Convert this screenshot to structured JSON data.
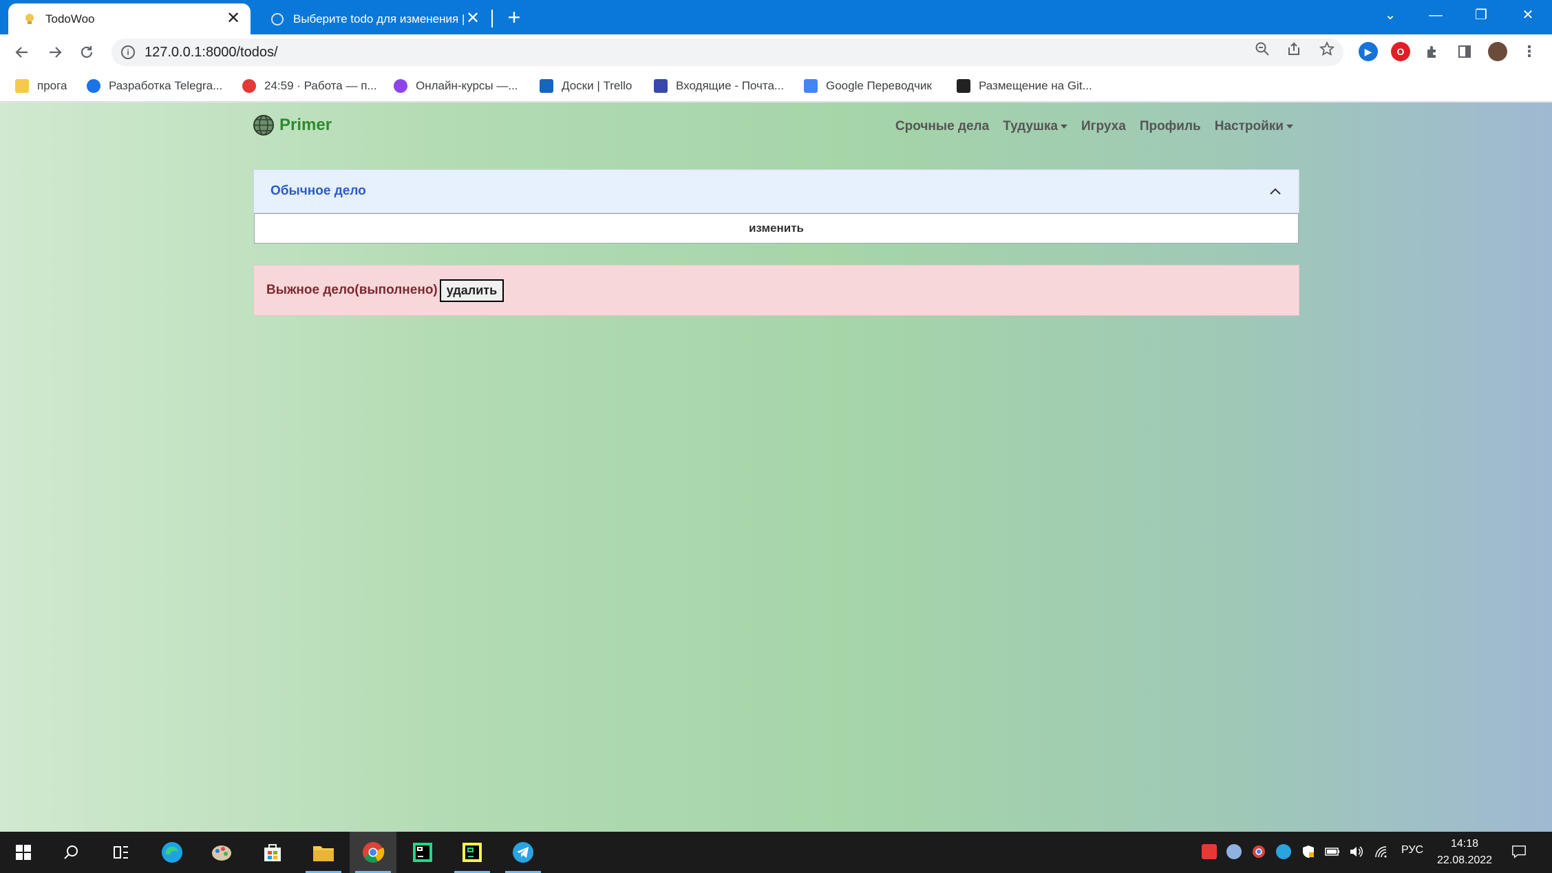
{
  "browser": {
    "tabs": [
      {
        "title": "TodoWoo",
        "close": "✕"
      },
      {
        "title": "Выберите todo для изменения |",
        "close": "✕"
      }
    ],
    "new_tab": "+",
    "window_controls": {
      "list": "⌄",
      "minimize": "—",
      "restore": "❐",
      "close": "✕"
    },
    "url": "127.0.0.1:8000/todos/",
    "bookmarks": [
      {
        "label": "прога",
        "icon": "folder-icon",
        "color": "#f6c94b"
      },
      {
        "label": "Разработка Telegra...",
        "icon": "cloud-icon",
        "color": "#1a73e8"
      },
      {
        "label": "24:59 · Работа — п...",
        "icon": "red-dot-icon",
        "color": "#e53935"
      },
      {
        "label": "Онлайн-курсы —...",
        "icon": "courses-icon",
        "color": "#8e44ec"
      },
      {
        "label": "Доски | Trello",
        "icon": "trello-icon",
        "color": "#1565c0"
      },
      {
        "label": "Входящие - Почта...",
        "icon": "mail-icon",
        "color": "#3949ab"
      },
      {
        "label": "Google Переводчик",
        "icon": "translate-icon",
        "color": "#4285f4"
      },
      {
        "label": "Размещение на Git...",
        "icon": "hexlet-icon",
        "color": "#222222"
      }
    ]
  },
  "app": {
    "brand": "Primer",
    "nav": [
      {
        "label": "Срочные дела",
        "dropdown": false
      },
      {
        "label": "Тудушка",
        "dropdown": true
      },
      {
        "label": "Игруха",
        "dropdown": false
      },
      {
        "label": "Профиль",
        "dropdown": false
      },
      {
        "label": "Настройки",
        "dropdown": true
      }
    ],
    "accordion": {
      "title": "Обычное дело",
      "action_label": "изменить"
    },
    "alert": {
      "text": "Выжное дело(выполнено)",
      "action_label": "удалить"
    }
  },
  "taskbar": {
    "language": "РУС",
    "time": "14:18",
    "date": "22.08.2022"
  }
}
